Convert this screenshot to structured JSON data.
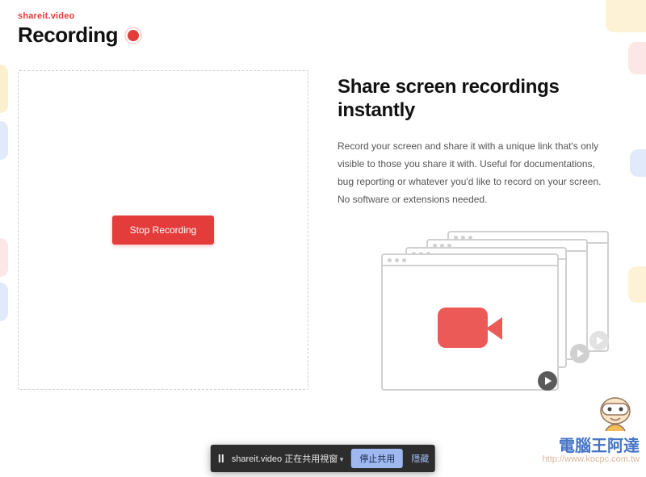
{
  "brand": "shareit.video",
  "status": "Recording",
  "stop_button": "Stop Recording",
  "headline": "Share screen recordings instantly",
  "description": "Record your screen and share it with a unique link that's only visible to those you share it with. Useful for documentations, bug reporting or whatever you'd like to record on your screen. No software or extensions needed.",
  "sharebar": {
    "message": "shareit.video 正在共用視窗",
    "stop": "停止共用",
    "hide": "隱藏"
  },
  "watermark": {
    "line1": "電腦王阿達",
    "line2": "http://www.kocpc.com.tw"
  }
}
